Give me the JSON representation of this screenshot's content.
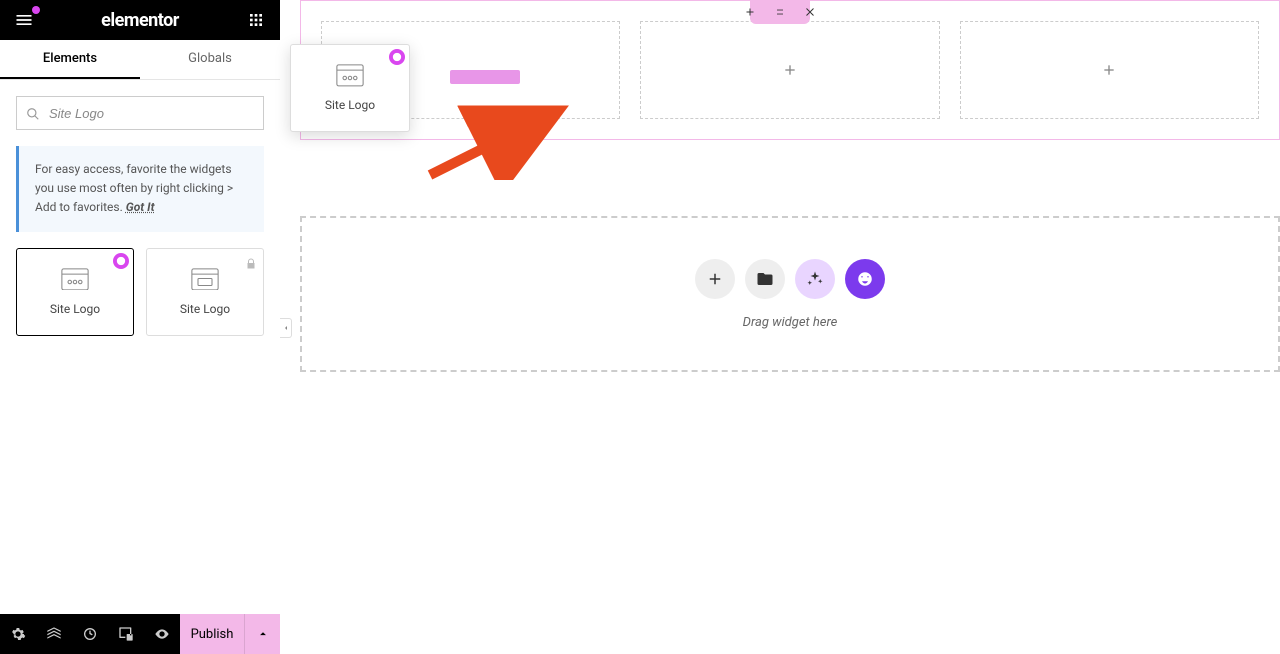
{
  "header": {
    "logo": "elementor"
  },
  "tabs": {
    "elements": "Elements",
    "globals": "Globals"
  },
  "search": {
    "value": "Site Logo"
  },
  "tip": {
    "text": "For easy access, favorite the widgets you use most often by right clicking > Add to favorites. ",
    "link": "Got It"
  },
  "widgets": [
    {
      "label": "Site Logo",
      "badge": true
    },
    {
      "label": "Site Logo",
      "locked": true
    }
  ],
  "drag_ghost": {
    "label": "Site Logo"
  },
  "dropzone": {
    "text": "Drag widget here"
  },
  "footer": {
    "publish": "Publish"
  }
}
